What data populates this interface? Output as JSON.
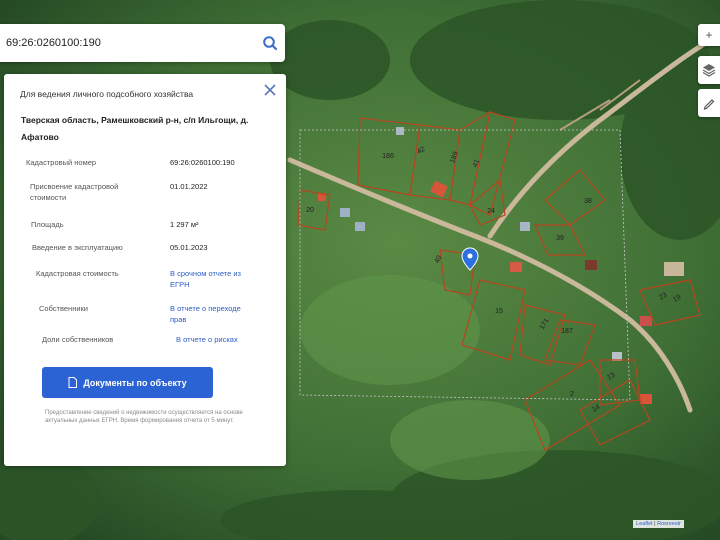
{
  "search": {
    "value": "69:26:0260100:190",
    "icon": "search-icon"
  },
  "panel": {
    "purpose": "Для ведения личного подсобного хозяйства",
    "address": "Тверская область, Рамешковский р-н, с/п Ильгощи, д. Афатово",
    "rows": [
      {
        "key": "Кадастровый номер",
        "value": "69:26:0260100:190"
      },
      {
        "key": "Присвоение кадастровой стоимости",
        "value": "01.01.2022"
      },
      {
        "key": "Площадь",
        "value": "1 297 м²"
      },
      {
        "key": "Введение в эксплуатацию",
        "value": "05.01.2023"
      },
      {
        "key": "Кадастровая стоимость",
        "value": "В срочном отчете из ЕГРН"
      },
      {
        "key": "Собственники",
        "value": "В отчете о переходе прав"
      },
      {
        "key": "Доли собственников",
        "value": "В отчете о рисках"
      }
    ],
    "docs_button": "Документы по объекту",
    "footnote": "Предоставление сведений о недвижимости осуществляется на основе актуальных данных ЕГРН. Время формирования отчета от 5 минут."
  },
  "map": {
    "parcel_labels": [
      "186",
      "42",
      "189",
      "41",
      "20",
      "24",
      "38",
      "39",
      "40",
      "15",
      "23",
      "19",
      "171",
      "187",
      "2",
      "14",
      "13"
    ],
    "attribution_leaflet": "Leaflet",
    "attribution_sep": " | ",
    "attribution_source": "Rosreestr"
  },
  "colors": {
    "accent": "#2b62d4",
    "link": "#2b5ec6",
    "parcel": "#b5461f",
    "road": "#c9b89a"
  }
}
